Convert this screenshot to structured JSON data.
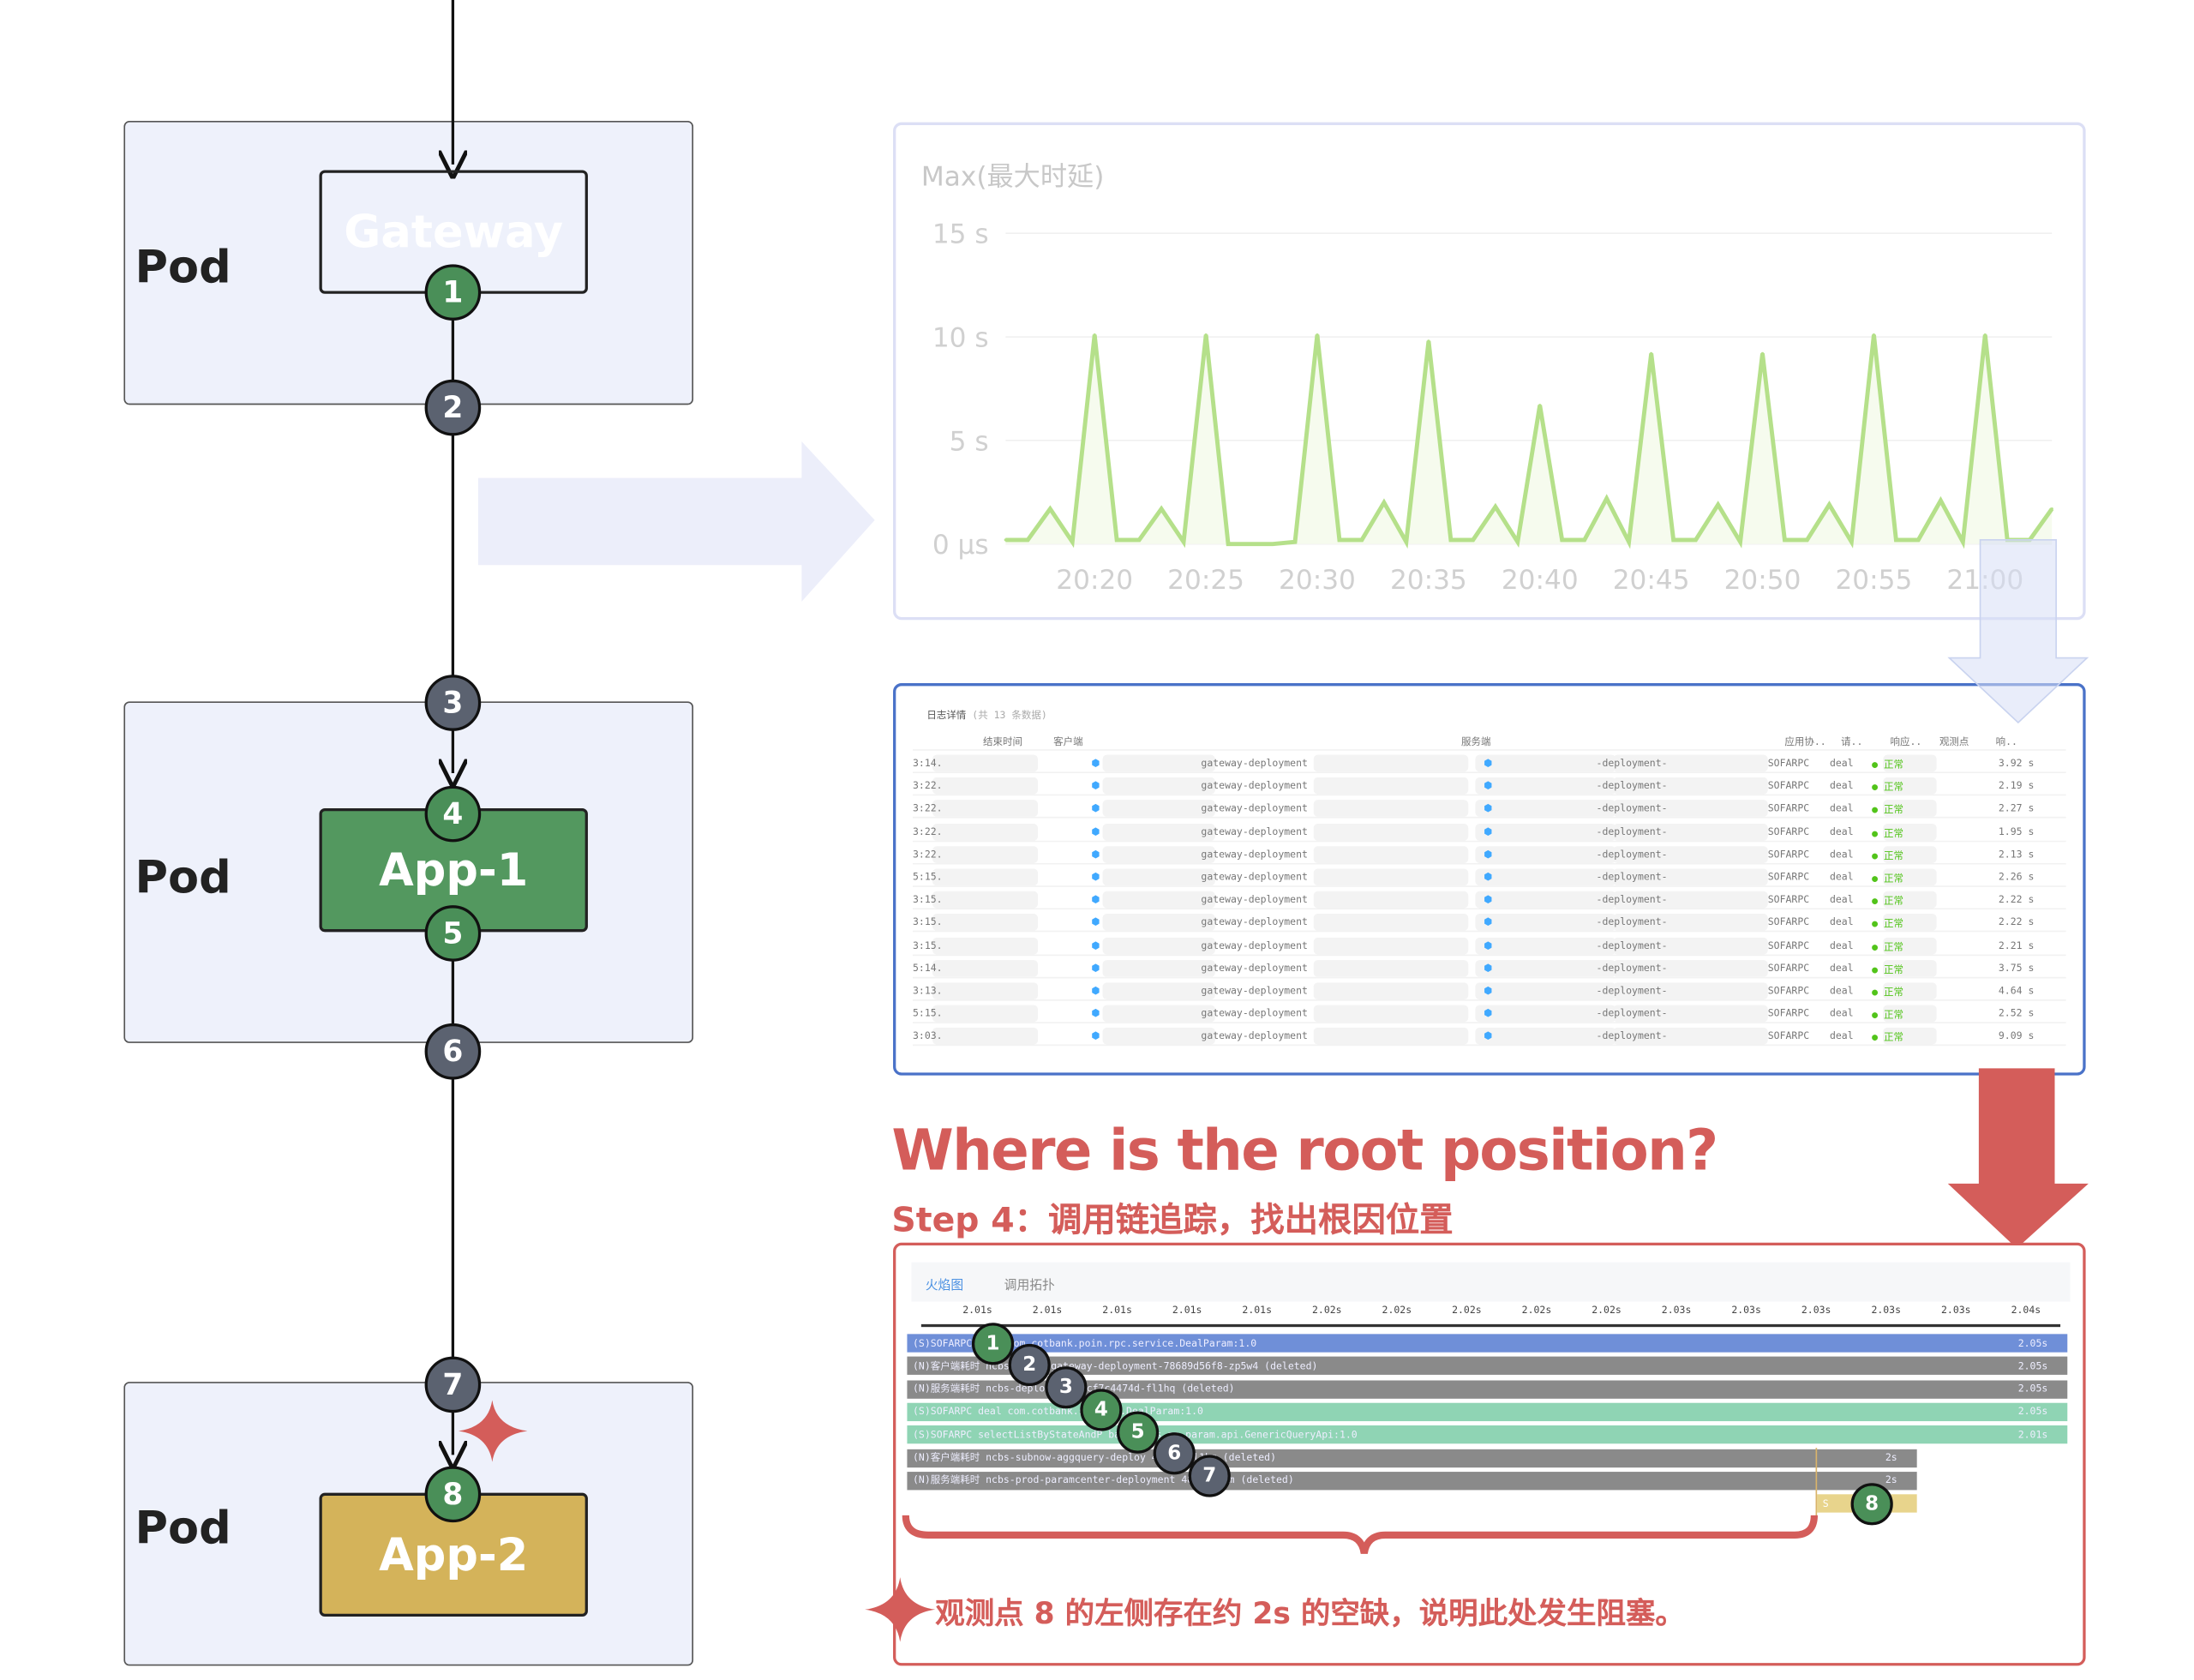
{
  "diagram": {
    "pods": [
      {
        "label": "Pod"
      },
      {
        "label": "Pod"
      },
      {
        "label": "Pod"
      }
    ],
    "services": [
      {
        "label": "Gateway",
        "color": "#4a72c8"
      },
      {
        "label": "App-1",
        "color": "#53985f"
      },
      {
        "label": "App-2",
        "color": "#d4b35a"
      }
    ],
    "markers": [
      "1",
      "2",
      "3",
      "4",
      "5",
      "6",
      "7",
      "8"
    ]
  },
  "chart_data": {
    "type": "area",
    "title": "Max(最大时延)",
    "y_ticks": [
      "0 μs",
      "5 s",
      "10 s",
      "15 s"
    ],
    "ylim": [
      0,
      15
    ],
    "x_ticks": [
      "20:20",
      "20:25",
      "20:30",
      "20:35",
      "20:40",
      "20:45",
      "20:50",
      "20:55",
      "21:00"
    ],
    "x": [
      "20:16",
      "20:17",
      "20:18",
      "20:19",
      "20:20",
      "20:21",
      "20:22",
      "20:23",
      "20:24",
      "20:25",
      "20:26",
      "20:27",
      "20:28",
      "20:29",
      "20:30",
      "20:31",
      "20:32",
      "20:33",
      "20:34",
      "20:35",
      "20:36",
      "20:37",
      "20:38",
      "20:39",
      "20:40",
      "20:41",
      "20:42",
      "20:43",
      "20:44",
      "20:45",
      "20:46",
      "20:47",
      "20:48",
      "20:49",
      "20:50",
      "20:51",
      "20:52",
      "20:53",
      "20:54",
      "20:55",
      "20:56",
      "20:57",
      "20:58",
      "20:59",
      "21:00",
      "21:01",
      "21:02",
      "21:03"
    ],
    "values": [
      0.2,
      0.2,
      1.7,
      0.1,
      10.1,
      0.2,
      0.2,
      1.7,
      0.1,
      10.1,
      0,
      0,
      0,
      0.1,
      10.1,
      0.2,
      0.2,
      2.0,
      0.1,
      9.8,
      0.2,
      0.2,
      1.8,
      0.1,
      6.7,
      0.2,
      0.2,
      2.2,
      0.1,
      9.2,
      0.2,
      0.2,
      1.9,
      0.1,
      9.2,
      0.2,
      0.2,
      1.9,
      0.1,
      10.1,
      0.2,
      0.2,
      2.1,
      0.1,
      10.1,
      0.2,
      0.2,
      1.7
    ],
    "line_color": "#b5e08a",
    "grid": true
  },
  "log_table": {
    "title": "日志详情",
    "count": "(共 13 条数据)",
    "columns": [
      "结束时间",
      "客户端",
      "服务端",
      "应用协..",
      "请..",
      "响应..",
      "观测点",
      "响.."
    ],
    "rows": [
      [
        "3:14.",
        "gateway-deployment",
        "-deployment-",
        "SOFARPC",
        "deal",
        "正常",
        "3.92 s"
      ],
      [
        "3:22.",
        "gateway-deployment",
        "-deployment-",
        "SOFARPC",
        "deal",
        "正常",
        "2.19 s"
      ],
      [
        "3:22.",
        "gateway-deployment",
        "-deployment-",
        "SOFARPC",
        "deal",
        "正常",
        "2.27 s"
      ],
      [
        "3:22.",
        "gateway-deployment",
        "-deployment-",
        "SOFARPC",
        "deal",
        "正常",
        "1.95 s"
      ],
      [
        "3:22.",
        "gateway-deployment",
        "-deployment-",
        "SOFARPC",
        "deal",
        "正常",
        "2.13 s"
      ],
      [
        "5:15.",
        "gateway-deployment",
        "-deployment-",
        "SOFARPC",
        "deal",
        "正常",
        "2.26 s"
      ],
      [
        "3:15.",
        "gateway-deployment",
        "-deployment-",
        "SOFARPC",
        "deal",
        "正常",
        "2.22 s"
      ],
      [
        "3:15.",
        "gateway-deployment",
        "-deployment-",
        "SOFARPC",
        "deal",
        "正常",
        "2.22 s"
      ],
      [
        "3:15.",
        "gateway-deployment",
        "-deployment-",
        "SOFARPC",
        "deal",
        "正常",
        "2.21 s"
      ],
      [
        "5:14.",
        "gateway-deployment",
        "-deployment-",
        "SOFARPC",
        "deal",
        "正常",
        "3.75 s"
      ],
      [
        "3:13.",
        "gateway-deployment",
        "-deployment-",
        "SOFARPC",
        "deal",
        "正常",
        "4.64 s"
      ],
      [
        "5:15.",
        "gateway-deployment",
        "-deployment-",
        "SOFARPC",
        "deal",
        "正常",
        "2.52 s"
      ],
      [
        "3:03.",
        "gateway-deployment",
        "-deployment-",
        "SOFARPC",
        "deal",
        "正常",
        "9.09 s"
      ]
    ]
  },
  "headline": {
    "title": "Where is the root position?",
    "subtitle": "Step 4：调用链追踪，找出根因位置",
    "color": "#d45d5a"
  },
  "flame": {
    "tabs": [
      "火焰图",
      "调用拓扑"
    ],
    "ticks": [
      "2.01s",
      "2.01s",
      "2.01s",
      "2.01s",
      "2.01s",
      "2.02s",
      "2.02s",
      "2.02s",
      "2.02s",
      "2.02s",
      "2.03s",
      "2.03s",
      "2.03s",
      "2.03s",
      "2.03s",
      "2.04s"
    ],
    "rows": [
      {
        "badge": "S",
        "text": "SOFARPC deal com.cotbank.poin.rpc.service.DealParam:1.0",
        "dur": "2.05s",
        "color": "#6f8fd8",
        "full": true
      },
      {
        "badge": "N",
        "text": "客户端耗时 ncbs-globalgateway-deployment-78689d56f8-zp5w4 (deleted)",
        "dur": "2.05s",
        "color": "#8a8a8a",
        "full": true
      },
      {
        "badge": "N",
        "text": "服务端耗时 ncbs-deployment-7cf7c4474d-fl1hq (deleted)",
        "dur": "2.05s",
        "color": "#8a8a8a",
        "full": true
      },
      {
        "badge": "S",
        "text": "SOFARPC deal com.cotbank.service.DealParam:1.0",
        "dur": "2.05s",
        "color": "#8fd4b4",
        "full": true
      },
      {
        "badge": "S",
        "text": "SOFARPC selectListByStateAndP bank.ncbs.ap.param.api.GenericQueryApi:1.0",
        "dur": "2.01s",
        "color": "#8fd4b4",
        "full": true
      },
      {
        "badge": "N",
        "text": "客户端耗时 ncbs-subnow-aggquery-deploy 4474d-fl1hq (deleted)",
        "dur": "2s",
        "color": "#8a8a8a",
        "full": false
      },
      {
        "badge": "N",
        "text": "服务端耗时 ncbs-prod-paramcenter-deployment 486-5rgbm (deleted)",
        "dur": "2s",
        "color": "#8a8a8a",
        "full": false
      }
    ],
    "last_badge": "S"
  },
  "note": "观测点 8 的左侧存在约 2s 的空缺，说明此处发生阻塞。"
}
